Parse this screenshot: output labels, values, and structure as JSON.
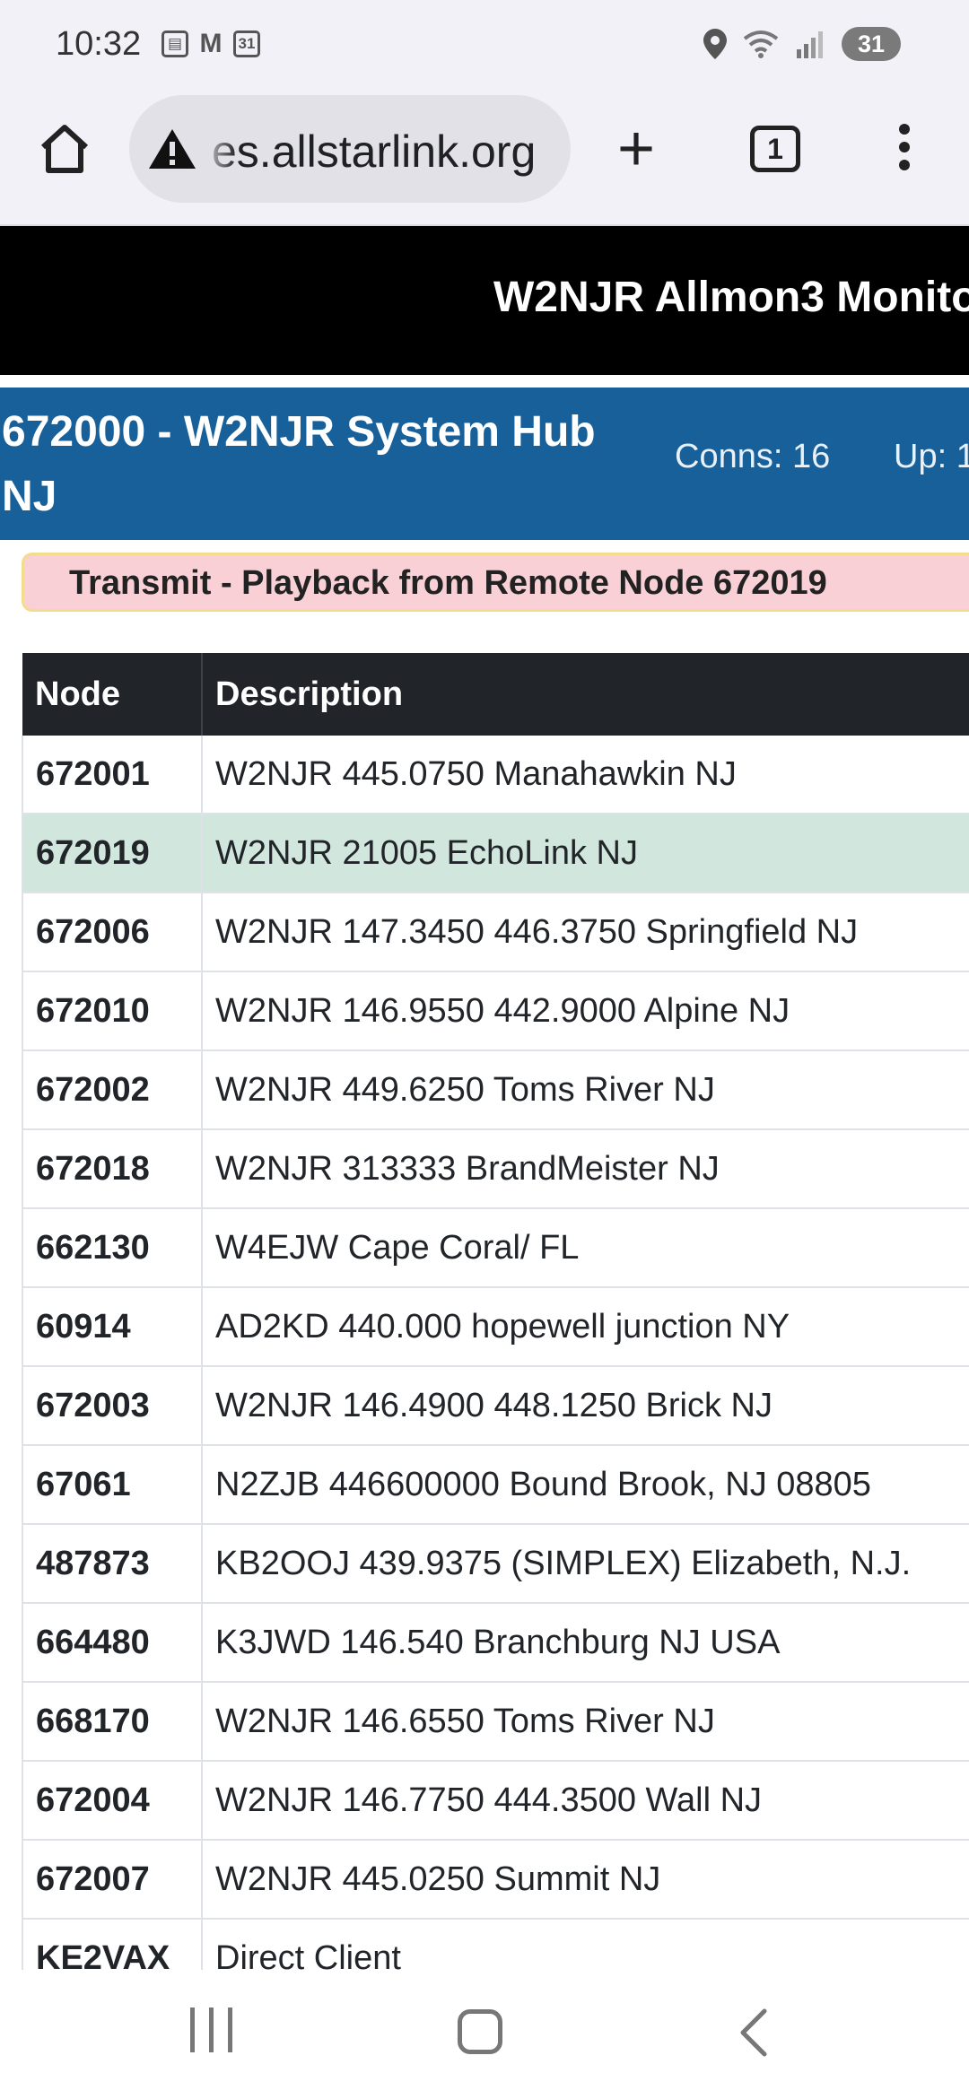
{
  "status_bar": {
    "time": "10:32",
    "left_icons": [
      "app-icon",
      "gmail-icon",
      "calendar-icon"
    ],
    "calendar_day": "31",
    "right_icons": [
      "location-icon",
      "wifi-icon",
      "signal-icon"
    ],
    "battery": "31"
  },
  "browser": {
    "url": "es.allstarlink.org",
    "tab_count": "1",
    "icons": [
      "home-icon",
      "warning-icon",
      "plus-icon",
      "tabs-icon",
      "more-vert-icon"
    ]
  },
  "site": {
    "title": "W2NJR Allmon3 Monito"
  },
  "node_header": {
    "title": "672000 - W2NJR System Hub NJ",
    "conns": "Conns: 16",
    "uptime": "Up: 1"
  },
  "alert": {
    "text": "Transmit - Playback from Remote Node 672019"
  },
  "table": {
    "headers": [
      "Node",
      "Description"
    ],
    "rows": [
      {
        "node": "672001",
        "desc": "W2NJR 445.0750 Manahawkin NJ"
      },
      {
        "node": "672019",
        "desc": "W2NJR 21005 EchoLink NJ"
      },
      {
        "node": "672006",
        "desc": "W2NJR 147.3450 446.3750 Springfield NJ"
      },
      {
        "node": "672010",
        "desc": "W2NJR 146.9550 442.9000 Alpine NJ"
      },
      {
        "node": "672002",
        "desc": "W2NJR 449.6250 Toms River NJ"
      },
      {
        "node": "672018",
        "desc": "W2NJR 313333 BrandMeister NJ"
      },
      {
        "node": "662130",
        "desc": "W4EJW Cape Coral/ FL"
      },
      {
        "node": "60914",
        "desc": "AD2KD 440.000 hopewell junction NY"
      },
      {
        "node": "672003",
        "desc": "W2NJR 146.4900 448.1250 Brick NJ"
      },
      {
        "node": "67061",
        "desc": "N2ZJB 446600000 Bound Brook, NJ 08805"
      },
      {
        "node": "487873",
        "desc": "KB2OOJ 439.9375 (SIMPLEX) Elizabeth, N.J."
      },
      {
        "node": "664480",
        "desc": "K3JWD 146.540 Branchburg NJ USA"
      },
      {
        "node": "668170",
        "desc": "W2NJR 146.6550 Toms River NJ"
      },
      {
        "node": "672004",
        "desc": "W2NJR 146.7750 444.3500 Wall NJ"
      },
      {
        "node": "672007",
        "desc": "W2NJR 445.0250 Summit NJ"
      },
      {
        "node": "KE2VAX",
        "desc": "Direct Client"
      }
    ]
  },
  "nav": {
    "icons": [
      "recent-apps-icon",
      "home-nav-icon",
      "back-icon"
    ]
  },
  "colors": {
    "header_black": "#000000",
    "node_header_blue": "#18609a",
    "alert_pink": "#f8d0d6",
    "active_row_green": "#d1e7dd",
    "table_header": "#212529"
  }
}
